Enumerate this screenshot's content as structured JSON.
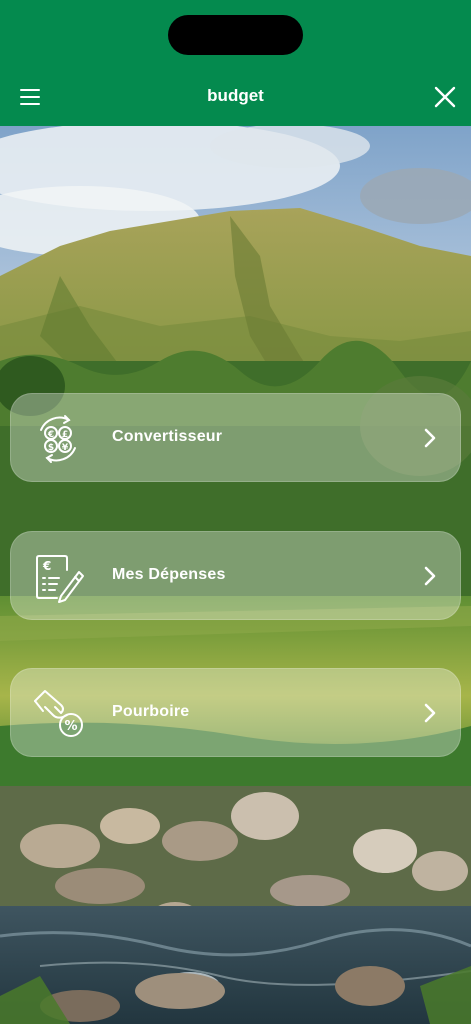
{
  "header": {
    "title": "budget",
    "menu_icon": "hamburger-menu-icon",
    "close_icon": "close-icon",
    "background_color": "#048a4e"
  },
  "menu": {
    "items": [
      {
        "label": "Convertisseur",
        "icon": "currency-converter-icon",
        "chevron": "chevron-right-icon"
      },
      {
        "label": "Mes Dépenses",
        "icon": "expenses-invoice-icon",
        "chevron": "chevron-right-icon"
      },
      {
        "label": "Pourboire",
        "icon": "tip-hand-coin-icon",
        "chevron": "chevron-right-icon"
      }
    ]
  },
  "background": {
    "description_icon": "landscape-photo"
  }
}
